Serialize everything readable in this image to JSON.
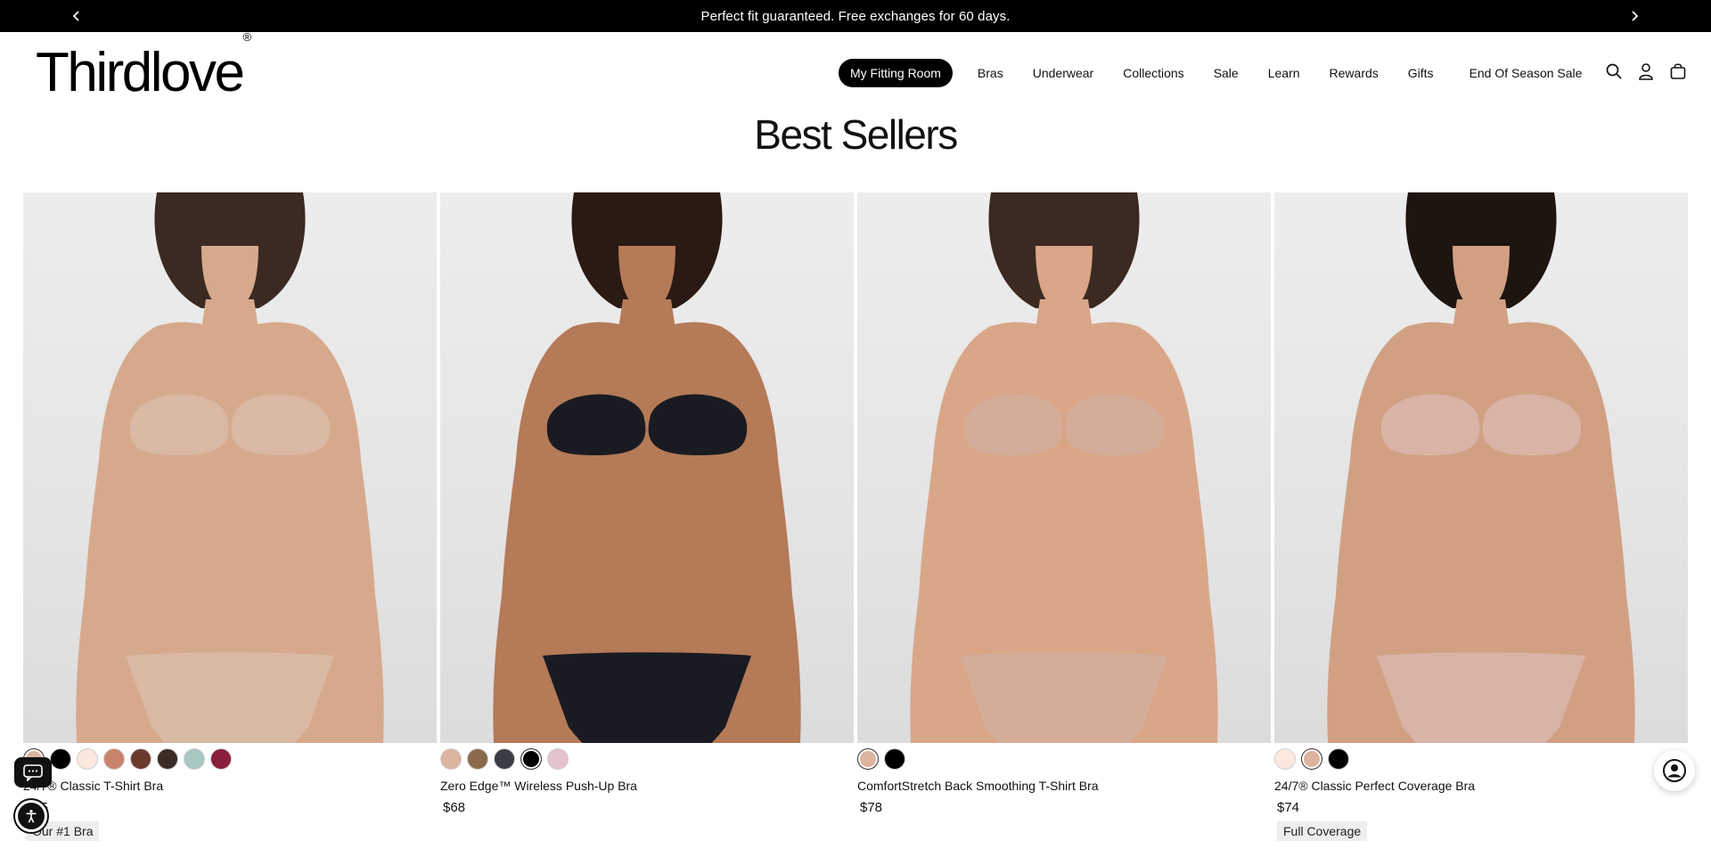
{
  "announcement": {
    "text": "Perfect fit guaranteed. Free exchanges for 60 days.",
    "prev_icon": "chevron-left-icon",
    "next_icon": "chevron-right-icon"
  },
  "header": {
    "logo": "Thirdlove",
    "logo_mark": "®",
    "nav": [
      "My Fitting Room",
      "Bras",
      "Underwear",
      "Collections",
      "Sale",
      "Learn",
      "Rewards",
      "Gifts",
      "End Of Season Sale"
    ],
    "icons": [
      "search-icon",
      "account-icon",
      "cart-icon"
    ]
  },
  "page": {
    "title": "Best Sellers"
  },
  "products": [
    {
      "name": "24/7® Classic T-Shirt Bra",
      "price": "$65",
      "tag": "Our #1 Bra",
      "swatches": [
        "#dcb49f",
        "#000000",
        "#fbe8df",
        "#c8836a",
        "#6b3a2e",
        "#3b2b25",
        "#a9c6c3",
        "#8b1e3c"
      ],
      "selected_swatch": 0,
      "model": {
        "skin": "#d7a98c",
        "garment": "#d9b8a4",
        "hair": "#3b2a22"
      }
    },
    {
      "name": "Zero Edge™ Wireless Push-Up Bra",
      "price": "$68",
      "tag": "",
      "swatches": [
        "#dcb49f",
        "#8a6a4a",
        "#3a3d44",
        "#000000",
        "#e4c1cf"
      ],
      "selected_swatch": 3,
      "model": {
        "skin": "#b57a57",
        "garment": "#1a1b22",
        "hair": "#2a1a14"
      }
    },
    {
      "name": "ComfortStretch Back Smoothing T-Shirt Bra",
      "price": "$78",
      "tag": "",
      "swatches": [
        "#dcb49f",
        "#000000"
      ],
      "selected_swatch": 0,
      "model": {
        "skin": "#d9a688",
        "garment": "#d3ad99",
        "hair": "#3b2a22"
      }
    },
    {
      "name": "24/7® Classic Perfect Coverage Bra",
      "price": "$74",
      "tag": "Full Coverage",
      "swatches": [
        "#fbe8df",
        "#dcb49f",
        "#000000"
      ],
      "selected_swatch": 1,
      "model": {
        "skin": "#d1a083",
        "garment": "#d9b3a6",
        "hair": "#1e1410"
      }
    }
  ],
  "floating": {
    "chat_icon": "chat-bubble-icon",
    "accessibility_icon": "accessibility-icon",
    "support_icon": "support-agent-icon"
  }
}
